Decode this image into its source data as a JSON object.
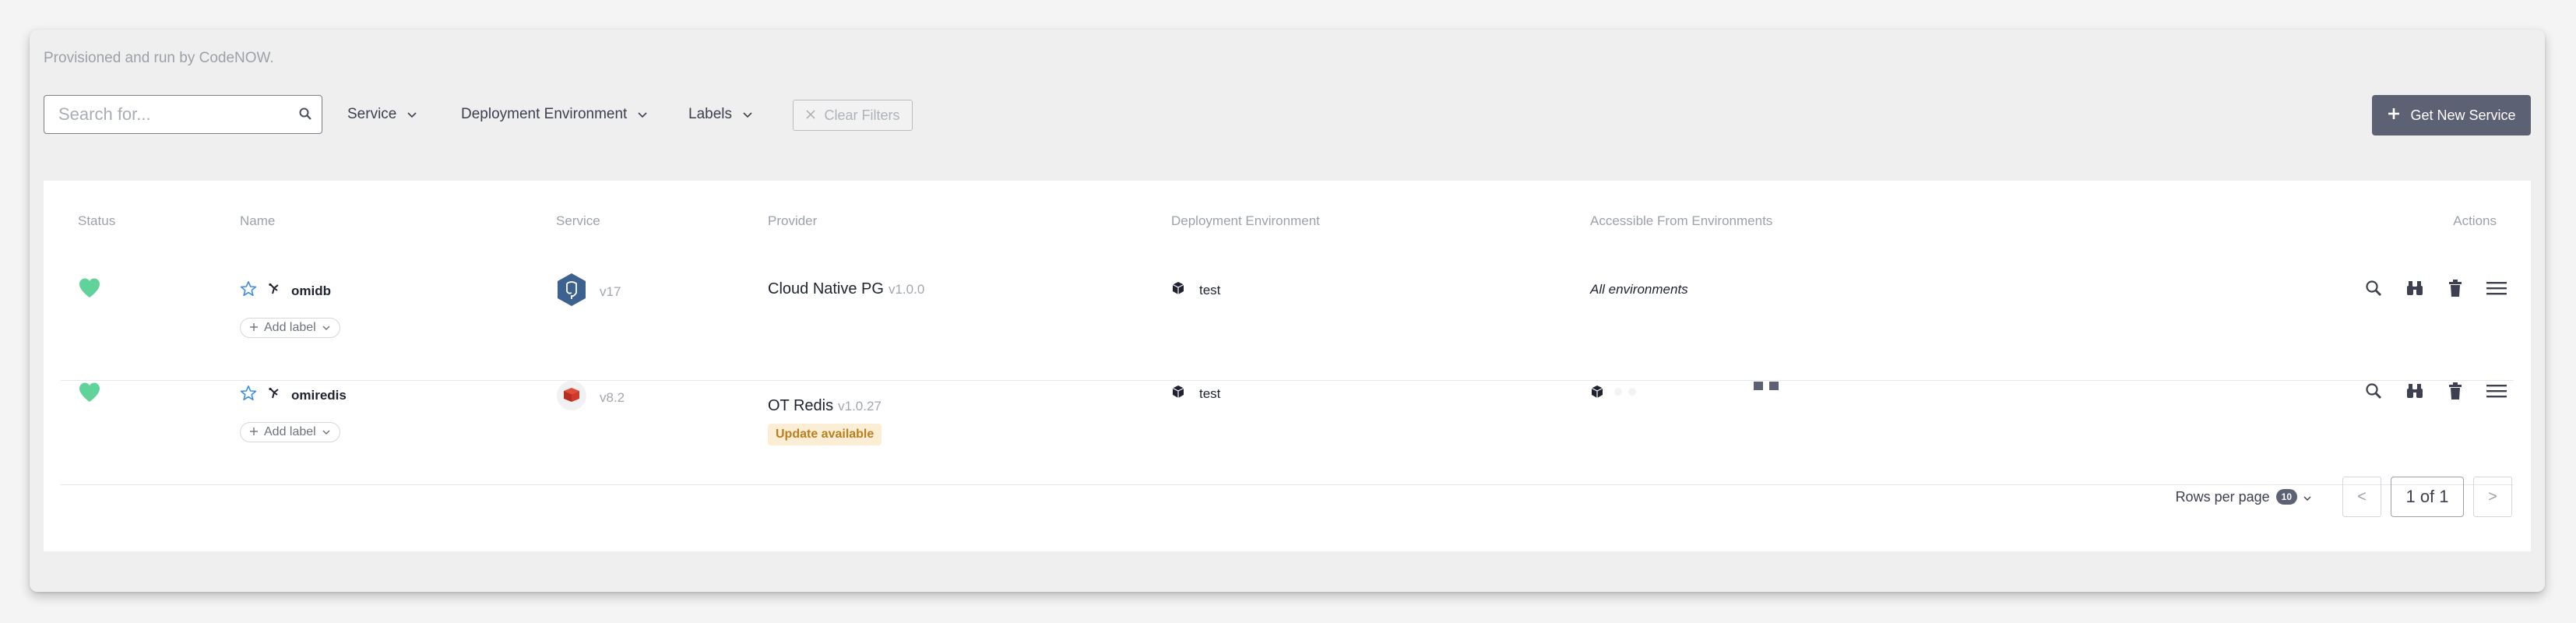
{
  "subtitle": "Provisioned and run by CodeNOW.",
  "search": {
    "placeholder": "Search for..."
  },
  "filters": {
    "service": "Service",
    "deployment_environment": "Deployment Environment",
    "labels": "Labels",
    "clear": "Clear Filters"
  },
  "new_service_label": "Get New Service",
  "columns": {
    "status": "Status",
    "name": "Name",
    "service": "Service",
    "provider": "Provider",
    "deployment_environment": "Deployment Environment",
    "accessible": "Accessible From Environments",
    "actions": "Actions"
  },
  "rows": [
    {
      "name": "omidb",
      "service_version": "v17",
      "provider": "Cloud Native PG",
      "provider_version": "v1.0.0",
      "environment": "test",
      "accessible": "All environments",
      "add_label": "Add label"
    },
    {
      "name": "omiredis",
      "service_version": "v8.2",
      "provider": "OT Redis",
      "provider_version": "v1.0.27",
      "update_badge": "Update available",
      "environment": "test",
      "add_label": "Add label"
    }
  ],
  "pagination": {
    "rows_per_page_label": "Rows per page",
    "rows_per_page": "10",
    "prev": "<",
    "page": "1 of 1",
    "next": ">"
  },
  "colors": {
    "status_healthy": "#5fd39a",
    "star": "#3d8de6",
    "primary_button": "#5c6174",
    "badge_bg": "#fbeed4",
    "badge_text": "#b97e1f"
  }
}
